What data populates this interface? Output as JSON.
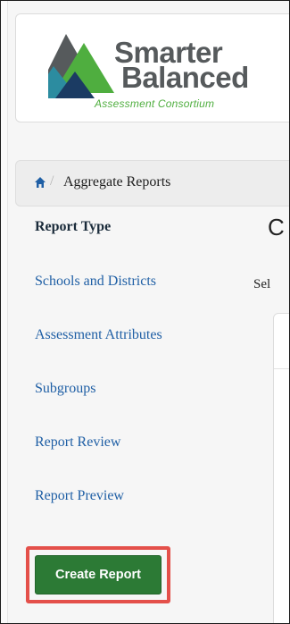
{
  "brand": {
    "name_line1": "Smarter",
    "name_line2": "Balanced",
    "tagline": "Assessment Consortium",
    "colors": {
      "gray": "#565a5c",
      "green": "#4fae3f",
      "teal": "#2c8ca0",
      "navy": "#1b3b63"
    }
  },
  "breadcrumb": {
    "home_icon": "home-icon",
    "separator": "/",
    "current": "Aggregate Reports"
  },
  "sidebar": {
    "title": "Report Type",
    "items": [
      {
        "label": "Schools and Districts"
      },
      {
        "label": "Assessment Attributes"
      },
      {
        "label": "Subgroups"
      },
      {
        "label": "Report Review"
      },
      {
        "label": "Report Preview"
      }
    ],
    "create_label": "Create Report"
  },
  "main": {
    "heading_partial": "C",
    "subtext_partial": "Sel"
  },
  "colors": {
    "link": "#1f5fa5",
    "button": "#2c7a35",
    "highlight": "#e4504a"
  }
}
